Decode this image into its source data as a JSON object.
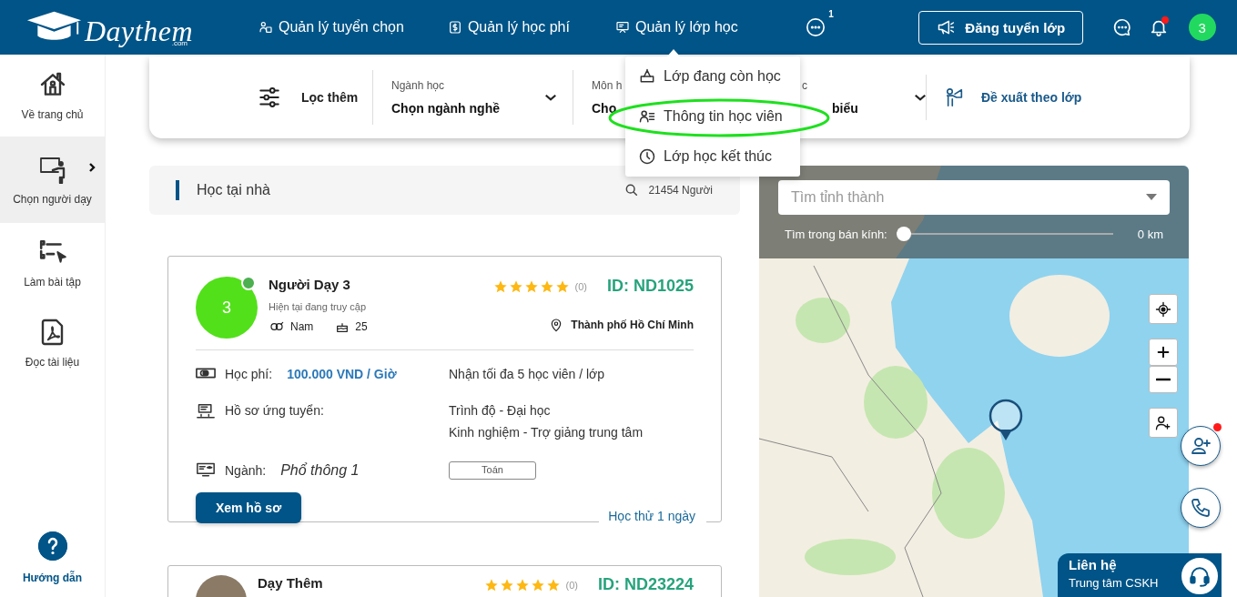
{
  "header": {
    "logo": {
      "name": "Daythem",
      "suffix": ".com"
    },
    "nav": [
      {
        "label": "Quản lý tuyển chọn"
      },
      {
        "label": "Quản lý học phí"
      },
      {
        "label": "Quản lý lớp học",
        "menu": [
          {
            "label": "Lớp đang còn học",
            "circled": false
          },
          {
            "label": "Thông tin học viên",
            "circled": true
          },
          {
            "label": "Lớp học kết thúc",
            "circled": false
          }
        ]
      }
    ],
    "more_badge": "1",
    "post_button": "Đăng tuyển lớp",
    "notification_dot": true,
    "avatar": "3"
  },
  "sidebar": {
    "items": [
      {
        "label": "Về trang chủ",
        "selected": false
      },
      {
        "label": "Chọn người dạy",
        "selected": true
      },
      {
        "label": "Làm bài tập",
        "selected": false
      },
      {
        "label": "Đọc tài liệu",
        "selected": false
      }
    ],
    "help": "Hướng dẫn"
  },
  "filter": {
    "more_label": "Lọc thêm",
    "groups": [
      {
        "label": "Ngành học",
        "value": "Chọn ngành nghề",
        "chevron": true
      },
      {
        "label": "Môn h",
        "value": "Chọ",
        "chevron": false
      },
      {
        "label": "c",
        "value": "biểu",
        "chevron": true
      }
    ],
    "suggest": "Đề xuất theo lớp"
  },
  "list_header": {
    "title": "Học tại nhà",
    "count": "21454 Người"
  },
  "tutors": [
    {
      "kind": "initial",
      "avatar": "3",
      "online": true,
      "name": "Người Dạy 3",
      "status": "Hiện tại đang truy cập",
      "gender": "Nam",
      "age": "25",
      "stars": 5,
      "reviews": "(0)",
      "id": "ID: ND1025",
      "location": "Thành phố Hồ Chí Minh",
      "fee_label": "Học phí:",
      "fee": "100.000 VND / Giờ",
      "capacity": "Nhận tối đa 5 học viên / lớp",
      "profile_label": "Hồ sơ ứng tuyển:",
      "profile": [
        "Trình độ - Đại học",
        "Kinh nghiệm - Trợ giảng trung tâm"
      ],
      "major_label": "Ngành:",
      "major": "Phổ thông 1",
      "subjects": [
        "Toán"
      ],
      "button": "Xem hồ sơ",
      "trial": "Học thử 1 ngày"
    },
    {
      "kind": "photo",
      "name": "Dạy Thêm",
      "stars": 5,
      "reviews": "(0)",
      "id": "ID: ND23224"
    }
  ],
  "map": {
    "search_placeholder": "Tìm tỉnh thành",
    "radius_label": "Tìm trong bán kính:",
    "radius": {
      "level": 0
    },
    "radius_value": "0 km"
  },
  "floating_buttons": [
    {
      "dot": true
    },
    {
      "dot": false
    }
  ],
  "contact": {
    "title": "Liên hệ",
    "subtitle": "Trung tâm CSKH"
  }
}
